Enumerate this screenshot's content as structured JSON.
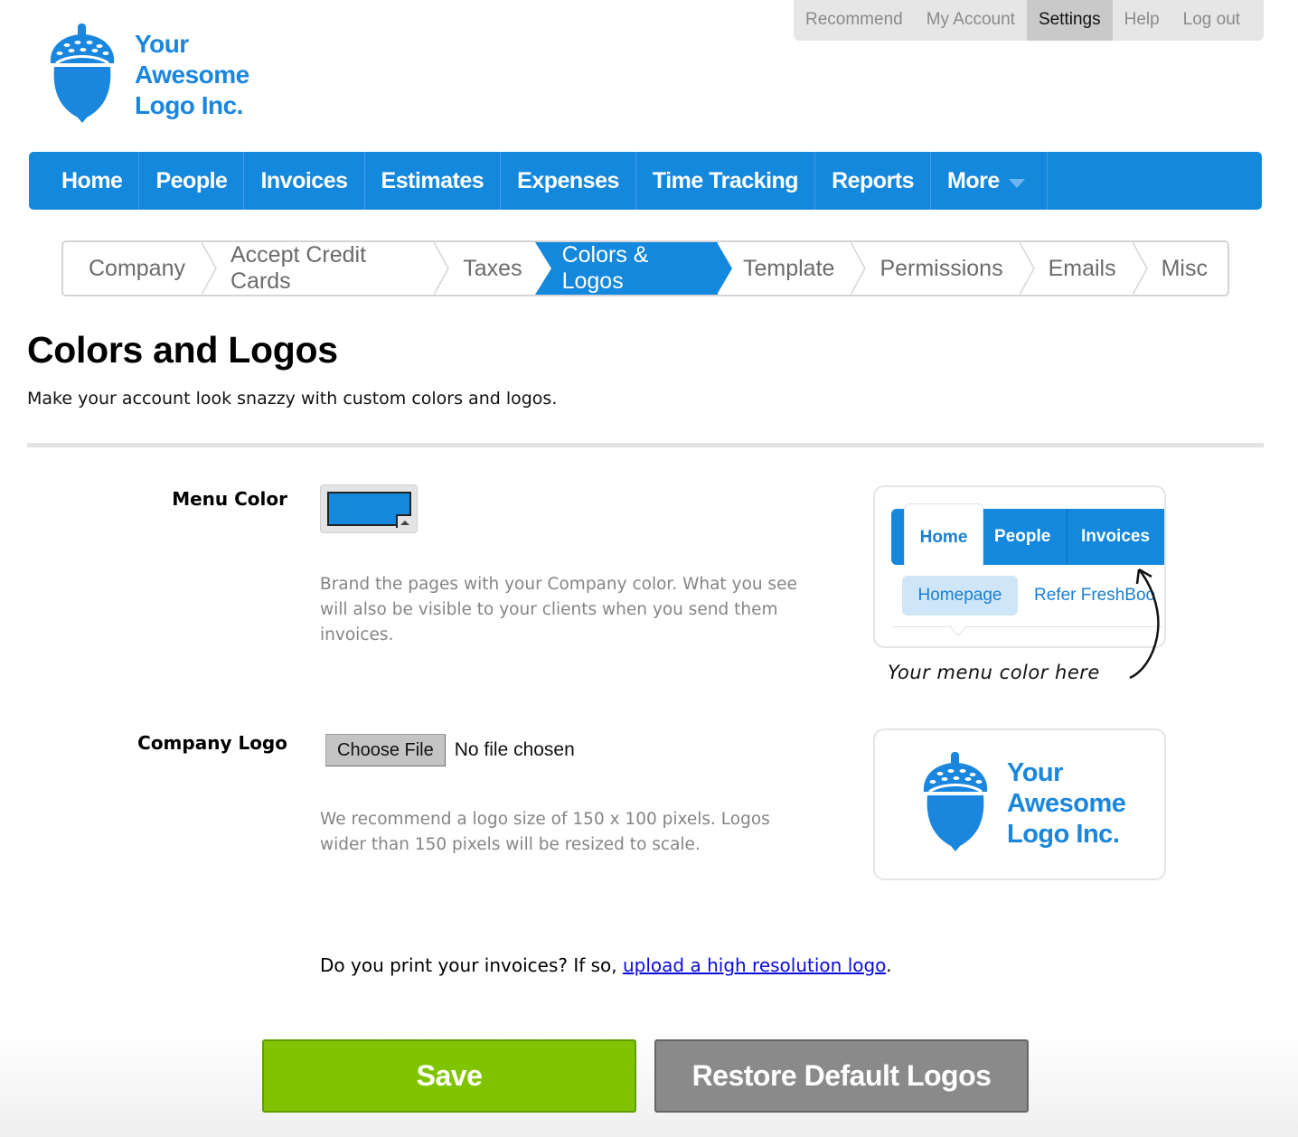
{
  "utility_nav": {
    "items": [
      {
        "label": "Recommend",
        "active": false
      },
      {
        "label": "My Account",
        "active": false
      },
      {
        "label": "Settings",
        "active": true
      },
      {
        "label": "Help",
        "active": false
      },
      {
        "label": "Log out",
        "active": false
      }
    ]
  },
  "logo": {
    "line1": "Your",
    "line2": "Awesome",
    "line3": "Logo Inc.",
    "icon": "acorn-icon",
    "color": "#1a86dd"
  },
  "main_nav": {
    "color": "#1488dc",
    "items": [
      {
        "label": "Home"
      },
      {
        "label": "People"
      },
      {
        "label": "Invoices"
      },
      {
        "label": "Estimates"
      },
      {
        "label": "Expenses"
      },
      {
        "label": "Time Tracking"
      },
      {
        "label": "Reports"
      },
      {
        "label": "More",
        "icon": "caret-down-icon"
      }
    ]
  },
  "settings_tabs": {
    "items": [
      {
        "label": "Company",
        "active": false
      },
      {
        "label": "Accept Credit Cards",
        "active": false
      },
      {
        "label": "Taxes",
        "active": false
      },
      {
        "label": "Colors & Logos",
        "active": true
      },
      {
        "label": "Template",
        "active": false
      },
      {
        "label": "Permissions",
        "active": false
      },
      {
        "label": "Emails",
        "active": false
      },
      {
        "label": "Misc",
        "active": false
      }
    ]
  },
  "page": {
    "title": "Colors and Logos",
    "subtitle": "Make your account look snazzy with custom colors and logos."
  },
  "menu_color": {
    "label": "Menu Color",
    "value": "#1488dc",
    "help": "Brand the pages with your Company color. What you see will also be visible to your clients when you send them invoices.",
    "preview": {
      "nav_items": [
        "Home",
        "People",
        "Invoices"
      ],
      "sub_items": [
        "Homepage",
        "Refer FreshBoo"
      ],
      "caption": "Your menu color here"
    }
  },
  "company_logo": {
    "label": "Company Logo",
    "button_label": "Choose File",
    "status": "No file chosen",
    "help": "We recommend a logo size of 150 x 100 pixels. Logos wider than 150 pixels will be resized to scale."
  },
  "print_note": {
    "prefix": "Do you print your invoices? If so, ",
    "link": "upload a high resolution logo",
    "suffix": "."
  },
  "actions": {
    "save_label": "Save",
    "restore_label": "Restore Default Logos",
    "save_color": "#80c400",
    "restore_color": "#8a8a8a"
  }
}
